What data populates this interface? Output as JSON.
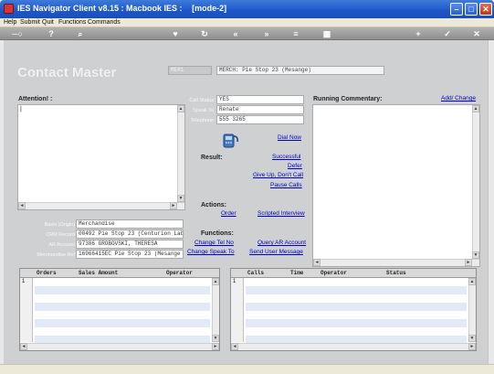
{
  "window": {
    "title": "IES Navigator Client v8.15 : Macbook IES :",
    "mode": "[mode-2]",
    "buttons": {
      "minimize": "–",
      "maximize": "□",
      "close": "✕"
    }
  },
  "menubar": {
    "items": [
      "Help",
      "Submit",
      "Quit",
      "Functions",
      "Commands"
    ]
  },
  "toolbar": {
    "icons": [
      {
        "name": "key-icon",
        "glyph": "─○"
      },
      {
        "name": "help-icon",
        "glyph": "?"
      },
      {
        "name": "search-icon",
        "glyph": "⌕"
      },
      {
        "name": "heart-icon",
        "glyph": "♥"
      },
      {
        "name": "refresh-icon",
        "glyph": "↻"
      },
      {
        "name": "rewind-icon",
        "glyph": "«"
      },
      {
        "name": "forward-icon",
        "glyph": "»"
      },
      {
        "name": "tree-icon",
        "glyph": "≡"
      },
      {
        "name": "grid-icon",
        "glyph": "▦"
      },
      {
        "name": "add-icon",
        "glyph": "+"
      },
      {
        "name": "check-icon",
        "glyph": "✓"
      },
      {
        "name": "cancel-icon",
        "glyph": "✕"
      }
    ]
  },
  "header": {
    "title": "Contact Master",
    "code": "MER1",
    "name": "MERCH: Pie Stop 23 (Mesange)"
  },
  "attention": {
    "label": "Attention! :",
    "value": "|"
  },
  "call": {
    "status_label": "Call Status",
    "status_value": "YES",
    "speak_to_label": "Speak To",
    "speak_to_value": "Renate",
    "telephone_label": "Telephone",
    "telephone_value": "555 3265",
    "dial_now": "Dial Now"
  },
  "result": {
    "label": "Result:",
    "options": [
      "Successful",
      "Defer",
      "Give Up, Don't Call",
      "Pause Calls"
    ]
  },
  "actions": {
    "label": "Actions:",
    "order": "Order",
    "scripted_interview": "Scripted Interview"
  },
  "functions": {
    "label": "Functions:",
    "change_tel_no": "Change Tel No",
    "change_speak_to": "Change Speak To",
    "query_ar_account": "Query AR Account",
    "send_user_message": "Send User Message"
  },
  "running_commentary": {
    "label": "Running Commentary:",
    "add_change": "Add/ Change"
  },
  "details": [
    {
      "label": "Basis (Origin)",
      "value": "Merchandise"
    },
    {
      "label": "CRM Record",
      "value": "00492 Pie Stop 23 (Centurion Lab"
    },
    {
      "label": "AR Account",
      "value": "97386 GROBOVSKI, THERESA"
    },
    {
      "label": "Merchandise Ref",
      "value": "16966415EC Pie Stop 23 (Mesange"
    }
  ],
  "orders_grid": {
    "columns": [
      "Orders",
      "Sales Amount",
      "Operator"
    ],
    "first_row": "1"
  },
  "calls_grid": {
    "columns": [
      "Calls",
      "Time",
      "Operator",
      "Status"
    ],
    "first_row": "1"
  },
  "colors": {
    "accent": "#1c56c8",
    "link": "#0000c8",
    "canvas": "#cfd0d2"
  }
}
